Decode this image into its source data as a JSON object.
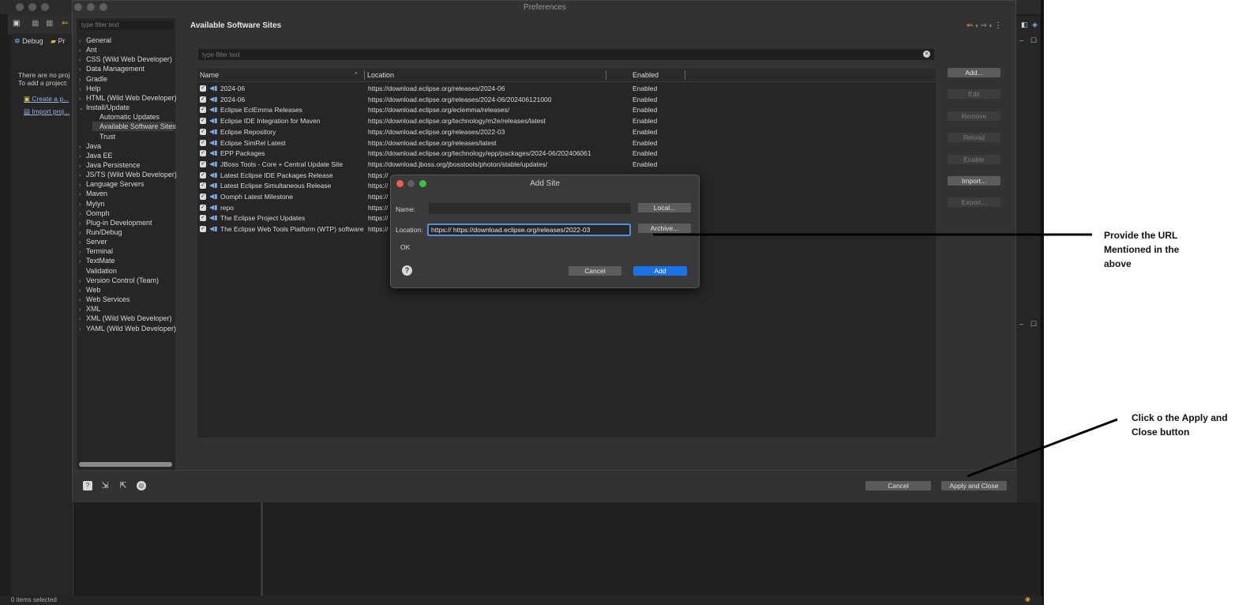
{
  "window": {
    "title": "Preferences",
    "status_text": "0 items selected"
  },
  "background": {
    "tabs": [
      "Debug",
      "Pr"
    ],
    "empty_msg_1": "There are no proj",
    "empty_msg_2": "To add a project:",
    "link_1": "Create a p...",
    "link_2": "Import proj..."
  },
  "tree": {
    "filter_placeholder": "type filter text",
    "items": [
      {
        "label": "General",
        "chev": "›",
        "indent": 0
      },
      {
        "label": "Ant",
        "chev": "›",
        "indent": 0
      },
      {
        "label": "CSS (Wild Web Developer)",
        "chev": "›",
        "indent": 0
      },
      {
        "label": "Data Management",
        "chev": "›",
        "indent": 0
      },
      {
        "label": "Gradle",
        "chev": "›",
        "indent": 0
      },
      {
        "label": "Help",
        "chev": "›",
        "indent": 0
      },
      {
        "label": "HTML (Wild Web Developer)",
        "chev": "›",
        "indent": 0
      },
      {
        "label": "Install/Update",
        "chev": "⌄",
        "indent": 0
      },
      {
        "label": "Automatic Updates",
        "chev": "",
        "indent": 1
      },
      {
        "label": "Available Software Sites",
        "chev": "",
        "indent": 1,
        "selected": true
      },
      {
        "label": "Trust",
        "chev": "",
        "indent": 1
      },
      {
        "label": "Java",
        "chev": "›",
        "indent": 0
      },
      {
        "label": "Java EE",
        "chev": "›",
        "indent": 0
      },
      {
        "label": "Java Persistence",
        "chev": "›",
        "indent": 0
      },
      {
        "label": "JS/TS (Wild Web Developer)",
        "chev": "›",
        "indent": 0
      },
      {
        "label": "Language Servers",
        "chev": "›",
        "indent": 0
      },
      {
        "label": "Maven",
        "chev": "›",
        "indent": 0
      },
      {
        "label": "Mylyn",
        "chev": "›",
        "indent": 0
      },
      {
        "label": "Oomph",
        "chev": "›",
        "indent": 0
      },
      {
        "label": "Plug-in Development",
        "chev": "›",
        "indent": 0
      },
      {
        "label": "Run/Debug",
        "chev": "›",
        "indent": 0
      },
      {
        "label": "Server",
        "chev": "›",
        "indent": 0
      },
      {
        "label": "Terminal",
        "chev": "›",
        "indent": 0
      },
      {
        "label": "TextMate",
        "chev": "›",
        "indent": 0
      },
      {
        "label": "Validation",
        "chev": "",
        "indent": 0
      },
      {
        "label": "Version Control (Team)",
        "chev": "›",
        "indent": 0
      },
      {
        "label": "Web",
        "chev": "›",
        "indent": 0
      },
      {
        "label": "Web Services",
        "chev": "›",
        "indent": 0
      },
      {
        "label": "XML",
        "chev": "›",
        "indent": 0
      },
      {
        "label": "XML (Wild Web Developer)",
        "chev": "›",
        "indent": 0
      },
      {
        "label": "YAML (Wild Web Developer)",
        "chev": "›",
        "indent": 0
      }
    ]
  },
  "page": {
    "title": "Available Software Sites",
    "filter_placeholder": "type filter text",
    "columns": {
      "name": "Name",
      "location": "Location",
      "enabled": "Enabled"
    },
    "rows": [
      {
        "name": "2024-06",
        "location": "https://download.eclipse.org/releases/2024-06",
        "enabled": "Enabled"
      },
      {
        "name": "2024-06",
        "location": "https://download.eclipse.org/releases/2024-06/202406121000",
        "enabled": "Enabled"
      },
      {
        "name": "Eclipse EclEmma Releases",
        "location": "https://download.eclipse.org/eclemma/releases/",
        "enabled": "Enabled"
      },
      {
        "name": "Eclipse IDE Integration for Maven",
        "location": "https://download.eclipse.org/technology/m2e/releases/latest",
        "enabled": "Enabled"
      },
      {
        "name": "Eclipse Repository",
        "location": "https://download.eclipse.org/releases/2022-03",
        "enabled": "Enabled"
      },
      {
        "name": "Eclipse SimRel Latest",
        "location": "https://download.eclipse.org/releases/latest",
        "enabled": "Enabled"
      },
      {
        "name": "EPP Packages",
        "location": "https://download.eclipse.org/technology/epp/packages/2024-06/202406061",
        "enabled": "Enabled"
      },
      {
        "name": "JBoss Tools - Core + Central Update Site",
        "location": "https://download.jboss.org/jbosstools/photon/stable/updates/",
        "enabled": "Enabled"
      },
      {
        "name": "Latest Eclipse IDE Packages Release",
        "location": "https://",
        "enabled": ""
      },
      {
        "name": "Latest Eclipse Simultaneous Release",
        "location": "https://",
        "enabled": ""
      },
      {
        "name": "Oomph Latest Milestone",
        "location": "https://",
        "enabled": ""
      },
      {
        "name": "repo",
        "location": "https://",
        "enabled": ""
      },
      {
        "name": "The Eclipse Project Updates",
        "location": "https://",
        "enabled": ""
      },
      {
        "name": "The Eclipse Web Tools Platform (WTP) software",
        "location": "https://",
        "enabled": ""
      }
    ],
    "side_buttons": [
      {
        "label": "Add...",
        "enabled": true
      },
      {
        "label": "Edit",
        "enabled": false
      },
      {
        "label": "Remove",
        "enabled": false
      },
      {
        "label": "Reload",
        "enabled": false
      },
      {
        "label": "Enable",
        "enabled": false
      },
      {
        "label": "Import...",
        "enabled": true
      },
      {
        "label": "Export...",
        "enabled": false
      }
    ]
  },
  "footer": {
    "cancel_label": "Cancel",
    "apply_close_label": "Apply and Close"
  },
  "add_site": {
    "title": "Add Site",
    "name_label": "Name:",
    "name_value": "",
    "location_label": "Location:",
    "location_value": "https:// https://download.eclipse.org/releases/2022-03",
    "local_label": "Local...",
    "archive_label": "Archive...",
    "ok_text": "OK",
    "cancel_label": "Cancel",
    "add_label": "Add"
  },
  "annotations": {
    "note_1": [
      "Provide the URL",
      "Mentioned in the",
      "above"
    ],
    "note_2": [
      "Click o the Apply and",
      "Close button"
    ]
  },
  "colors": {
    "accent": "#1a73e8",
    "close": "#ed5d52",
    "minimize": "#5e5e5e",
    "zoom": "#3fc03f"
  }
}
